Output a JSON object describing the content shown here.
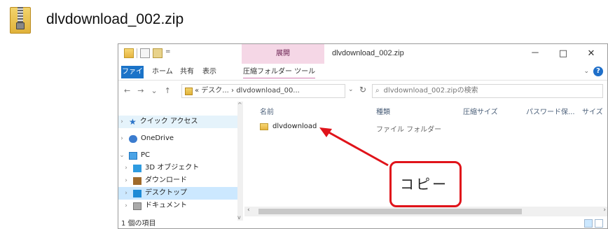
{
  "heading": {
    "filename": "dlvdownload_002.zip"
  },
  "window": {
    "title": "dlvdownload_002.zip",
    "manage_tab": "展開",
    "min_btn": "－",
    "max_btn": "□",
    "close_btn": "✕"
  },
  "ribbon": {
    "tabs": [
      "ファイル",
      "ホーム",
      "共有",
      "表示",
      "圧縮フォルダー ツール"
    ],
    "collapse": "⌄",
    "help": "?"
  },
  "address": {
    "path": "« デスク... › dlvdownload_00...",
    "search_placeholder": "dlvdownload_002.zipの検索"
  },
  "nav": {
    "items": [
      {
        "label": "クイック アクセス",
        "icon": "star-icon"
      },
      {
        "label": "OneDrive",
        "icon": "cloud-icon"
      },
      {
        "label": "PC",
        "icon": "computer-icon"
      },
      {
        "label": "3D オブジェクト",
        "icon": "cube-icon"
      },
      {
        "label": "ダウンロード",
        "icon": "download-icon"
      },
      {
        "label": "デスクトップ",
        "icon": "desktop-icon"
      },
      {
        "label": "ドキュメント",
        "icon": "document-icon"
      }
    ]
  },
  "columns": [
    "名前",
    "種類",
    "圧縮サイズ",
    "パスワード保...",
    "サイズ"
  ],
  "rows": [
    {
      "name": "dlvdownload",
      "type": "ファイル フォルダー"
    }
  ],
  "status": {
    "count": "1 個の項目"
  },
  "annotation": {
    "text": "コピー",
    "color": "#e0131a"
  }
}
